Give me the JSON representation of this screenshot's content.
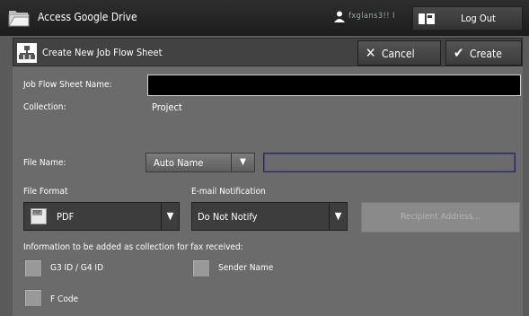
{
  "topbar": {
    "title": "Access Google Drive",
    "user_name": "fxglans3!! I",
    "logout_label": "Log Out"
  },
  "header": {
    "title": "Create New Job Flow Sheet",
    "cancel_label": "Cancel",
    "create_label": "Create"
  },
  "form": {
    "sheet_name_label": "Job Flow Sheet Name:",
    "sheet_name_value": "",
    "collection_label": "Collection:",
    "collection_value": "Project",
    "file_name_label": "File Name:",
    "file_name_mode": "Auto Name",
    "file_name_value": "",
    "file_format_label": "File Format",
    "file_format_value": "PDF",
    "pdf_icon_text": "PDF",
    "email_label": "E-mail Notification",
    "email_value": "Do Not Notify",
    "recipient_label": "Recipient Address...",
    "fax_info_label": "Information to be added as collection for fax received:",
    "checkboxes": [
      {
        "label": "G3 ID / G4 ID",
        "checked": false
      },
      {
        "label": "Sender Name",
        "checked": false
      },
      {
        "label": "F Code",
        "checked": false
      }
    ]
  }
}
